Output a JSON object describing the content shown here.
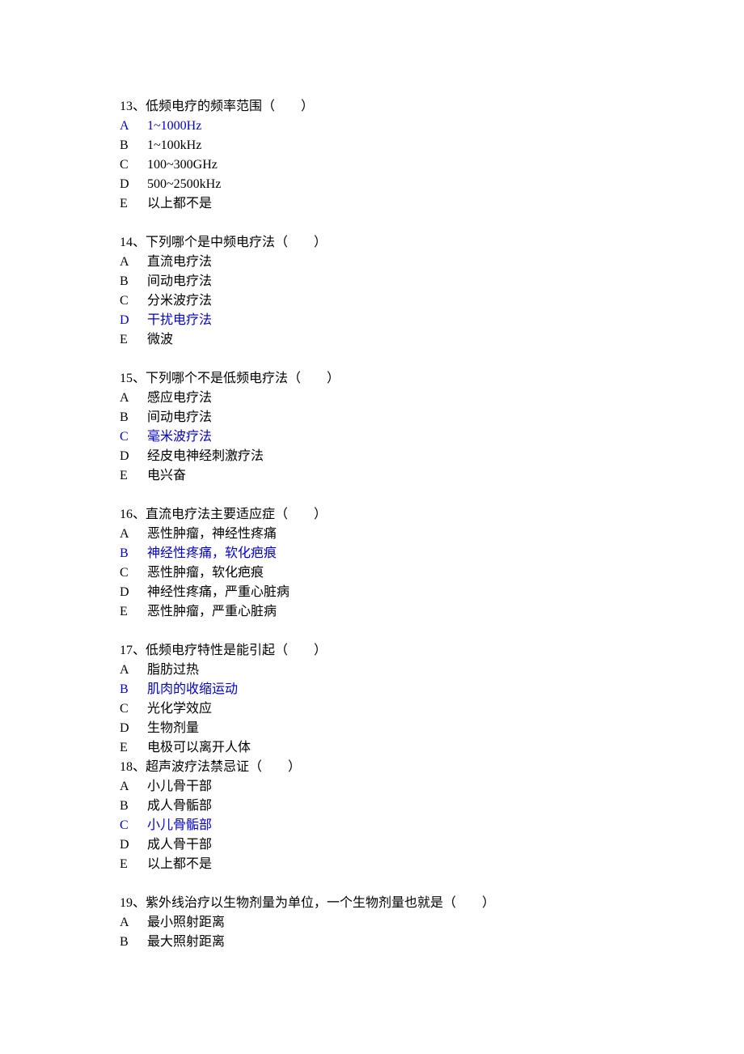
{
  "questions": [
    {
      "number": "13",
      "title": "13、低频电疗的频率范围（　　）",
      "options": [
        {
          "letter": "A",
          "text": "1~1000Hz",
          "highlighted": true
        },
        {
          "letter": "B",
          "text": "1~100kHz",
          "highlighted": false
        },
        {
          "letter": "C",
          "text": "100~300GHz",
          "highlighted": false
        },
        {
          "letter": "D",
          "text": "500~2500kHz",
          "highlighted": false
        },
        {
          "letter": "E",
          "text": "以上都不是",
          "highlighted": false
        }
      ],
      "gap_after": true
    },
    {
      "number": "14",
      "title": "14、下列哪个是中频电疗法（　　）",
      "options": [
        {
          "letter": "A",
          "text": "直流电疗法",
          "highlighted": false
        },
        {
          "letter": "B",
          "text": "间动电疗法",
          "highlighted": false
        },
        {
          "letter": "C",
          "text": "分米波疗法",
          "highlighted": false
        },
        {
          "letter": "D",
          "text": "干扰电疗法",
          "highlighted": true
        },
        {
          "letter": "E",
          "text": "微波",
          "highlighted": false
        }
      ],
      "gap_after": true
    },
    {
      "number": "15",
      "title": "15、下列哪个不是低频电疗法（　　）",
      "options": [
        {
          "letter": "A",
          "text": "感应电疗法",
          "highlighted": false
        },
        {
          "letter": "B",
          "text": "间动电疗法",
          "highlighted": false
        },
        {
          "letter": "C",
          "text": "毫米波疗法",
          "highlighted": true
        },
        {
          "letter": "D",
          "text": "经皮电神经刺激疗法",
          "highlighted": false
        },
        {
          "letter": "E",
          "text": "电兴奋",
          "highlighted": false
        }
      ],
      "gap_after": true
    },
    {
      "number": "16",
      "title": "16、直流电疗法主要适应症（　　）",
      "options": [
        {
          "letter": "A",
          "text": "恶性肿瘤，神经性疼痛",
          "highlighted": false
        },
        {
          "letter": "B",
          "text": "神经性疼痛，软化疤痕",
          "highlighted": true
        },
        {
          "letter": "C",
          "text": "恶性肿瘤，软化疤痕",
          "highlighted": false
        },
        {
          "letter": "D",
          "text": "神经性疼痛，严重心脏病",
          "highlighted": false
        },
        {
          "letter": "E",
          "text": "恶性肿瘤，严重心脏病",
          "highlighted": false
        }
      ],
      "gap_after": true
    },
    {
      "number": "17",
      "title": "17、低频电疗特性是能引起（　　）",
      "options": [
        {
          "letter": "A",
          "text": "脂肪过热",
          "highlighted": false
        },
        {
          "letter": "B",
          "text": "肌肉的收缩运动",
          "highlighted": true
        },
        {
          "letter": "C",
          "text": "光化学效应",
          "highlighted": false
        },
        {
          "letter": "D",
          "text": "生物剂量",
          "highlighted": false
        },
        {
          "letter": "E",
          "text": "电极可以离开人体",
          "highlighted": false
        }
      ],
      "gap_after": false
    },
    {
      "number": "18",
      "title": "18、超声波疗法禁忌证（　　）",
      "options": [
        {
          "letter": "A",
          "text": "小儿骨干部",
          "highlighted": false
        },
        {
          "letter": "B",
          "text": "成人骨骺部",
          "highlighted": false
        },
        {
          "letter": "C",
          "text": "小儿骨骺部",
          "highlighted": true
        },
        {
          "letter": "D",
          "text": "成人骨干部",
          "highlighted": false
        },
        {
          "letter": "E",
          "text": "以上都不是",
          "highlighted": false
        }
      ],
      "gap_after": true
    },
    {
      "number": "19",
      "title": "19、紫外线治疗以生物剂量为单位，一个生物剂量也就是（　　）",
      "options": [
        {
          "letter": "A",
          "text": "最小照射距离",
          "highlighted": false
        },
        {
          "letter": "B",
          "text": "最大照射距离",
          "highlighted": false
        }
      ],
      "gap_after": false
    }
  ]
}
